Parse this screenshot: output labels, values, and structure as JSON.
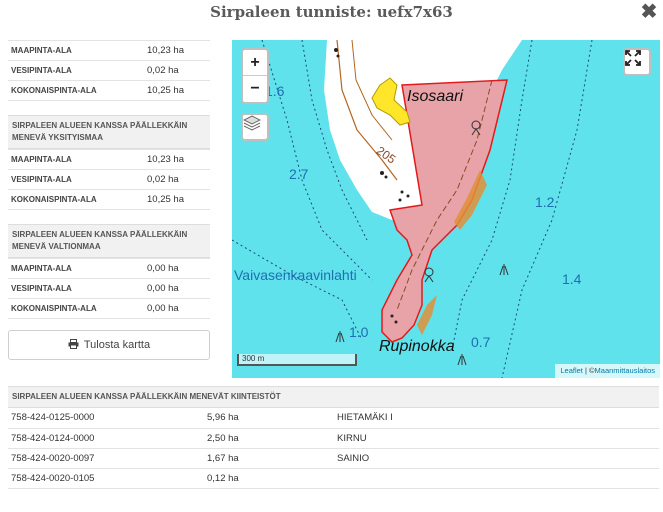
{
  "header": {
    "title": "Sirpaleen tunniste: uefx7x63",
    "close_glyph": "✖"
  },
  "summary_rows": [
    {
      "label": "MAAPINTA-ALA",
      "value": "10,23 ha"
    },
    {
      "label": "VESIPINTA-ALA",
      "value": "0,02 ha"
    },
    {
      "label": "KOKONAISPINTA-ALA",
      "value": "10,25 ha"
    }
  ],
  "private_section": {
    "heading": "SIRPALEEN ALUEEN KANSSA PÄÄLLEKKÄIN MENEVÄ YKSITYISMAA",
    "rows": [
      {
        "label": "MAAPINTA-ALA",
        "value": "10,23 ha"
      },
      {
        "label": "VESIPINTA-ALA",
        "value": "0,02 ha"
      },
      {
        "label": "KOKONAISPINTA-ALA",
        "value": "10,25 ha"
      }
    ]
  },
  "state_section": {
    "heading": "SIRPALEEN ALUEEN KANSSA PÄÄLLEKKÄIN MENEVÄ VALTIONMAA",
    "rows": [
      {
        "label": "MAAPINTA-ALA",
        "value": "0,00 ha"
      },
      {
        "label": "VESIPINTA-ALA",
        "value": "0,00 ha"
      },
      {
        "label": "KOKONAISPINTA-ALA",
        "value": "0,00 ha"
      }
    ]
  },
  "print_button": {
    "label": "Tulosta kartta",
    "icon": "printer-icon"
  },
  "map": {
    "zoom_in": "+",
    "zoom_out": "−",
    "labels": {
      "isosaari": "Isosaari",
      "rupinokka": "Rupinokka",
      "bay": "Vaivasenkaavinlahti",
      "contour": "205",
      "depth_16": "1.6",
      "depth_27": "2.7",
      "depth_12": "1.2",
      "depth_14": "1.4",
      "depth_10": "1.0",
      "depth_07": "0.7"
    },
    "scale_label": "300 m",
    "attribution": {
      "leaflet": "Leaflet",
      "sep": " | ©",
      "provider": "Maanmittauslaitos"
    },
    "colors": {
      "water": "#5fe2ec",
      "land": "#ffffff",
      "parcel_fill": "#e8a3a8",
      "parcel_border": "#e31a1c",
      "marker": "#ffe62a"
    }
  },
  "parcels_section": {
    "heading": "SIRPALEEN ALUEEN KANSSA PÄÄLLEKKÄIN MENEVÄT KIINTEISTÖT",
    "rows": [
      {
        "id": "758-424-0125-0000",
        "area": "5,96 ha",
        "name": "HIETAMÄKI I"
      },
      {
        "id": "758-424-0124-0000",
        "area": "2,50 ha",
        "name": "KIRNU"
      },
      {
        "id": "758-424-0020-0097",
        "area": "1,67 ha",
        "name": "SAINIO"
      },
      {
        "id": "758-424-0020-0105",
        "area": "0,12 ha",
        "name": ""
      }
    ]
  }
}
